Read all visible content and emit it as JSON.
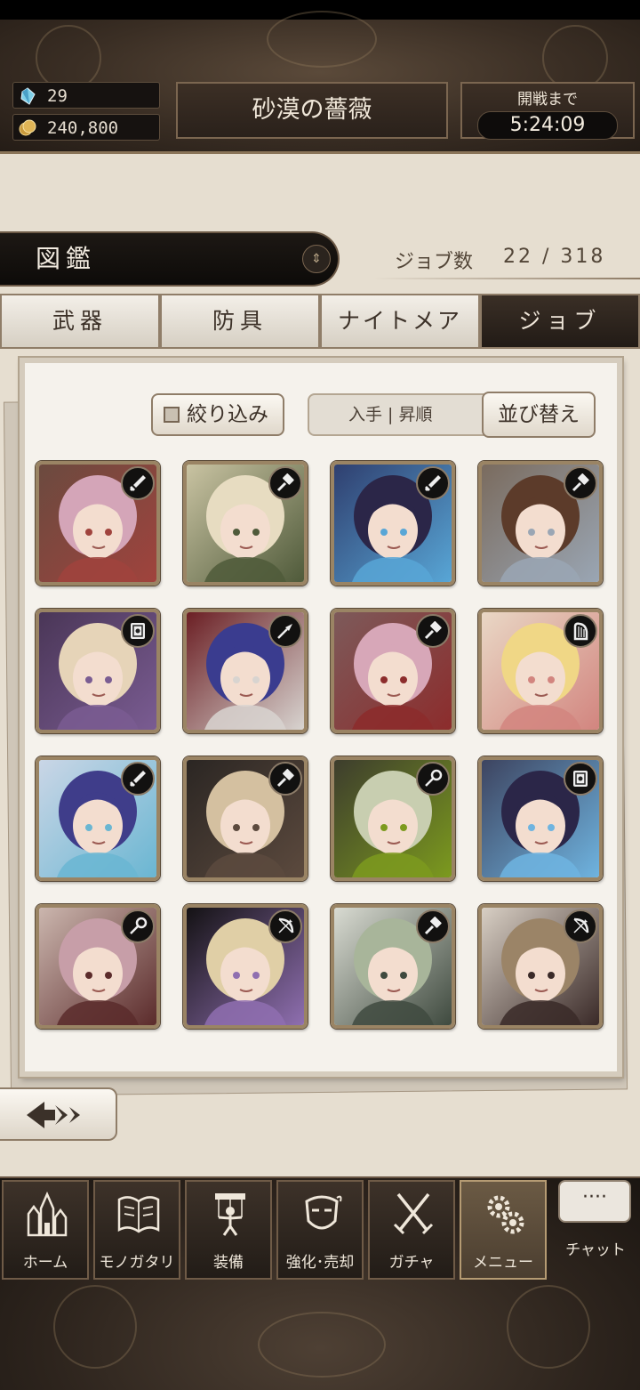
{
  "header": {
    "crystal_count": "29",
    "gold_count": "240,800",
    "stage_name": "砂漠の薔薇",
    "open_label": "開戦まで",
    "open_timer": "5:24:09"
  },
  "title": {
    "text": "図鑑",
    "job_count_label": "ジョブ数",
    "job_count_value": "22 / 318"
  },
  "tabs": [
    {
      "label": "武器",
      "active": false
    },
    {
      "label": "防具",
      "active": false
    },
    {
      "label": "ナイトメア",
      "active": false
    },
    {
      "label": "ジョブ",
      "active": true
    }
  ],
  "controls": {
    "filter_label": "絞り込み",
    "sort_current": "入手 | 昇順",
    "sort_button": "並び替え"
  },
  "jobs": [
    {
      "weapon_icon": "sword-icon",
      "palette": [
        "#6b4a3f",
        "#d4a5b8",
        "#a0433d"
      ]
    },
    {
      "weapon_icon": "hammer-icon",
      "palette": [
        "#c9c3a2",
        "#e7dcc1",
        "#4f5a3a"
      ]
    },
    {
      "weapon_icon": "sword-icon",
      "palette": [
        "#2f3f6f",
        "#2b2648",
        "#58a6d6"
      ]
    },
    {
      "weapon_icon": "hammer-icon",
      "palette": [
        "#7a6b5e",
        "#5c3b2a",
        "#9aa6b4"
      ]
    },
    {
      "weapon_icon": "tome-icon",
      "palette": [
        "#4a3657",
        "#e6d4b8",
        "#7a5c92"
      ]
    },
    {
      "weapon_icon": "spear-icon",
      "palette": [
        "#6b1f24",
        "#3a3c8f",
        "#d8d4d0"
      ]
    },
    {
      "weapon_icon": "hammer-icon",
      "palette": [
        "#7d5a5a",
        "#d7a7b8",
        "#8c2c2c"
      ]
    },
    {
      "weapon_icon": "harp-icon",
      "palette": [
        "#e9d7c5",
        "#f0d786",
        "#d2857f"
      ]
    },
    {
      "weapon_icon": "sword-icon",
      "palette": [
        "#cad6e6",
        "#3f3d8a",
        "#6ab6d2"
      ]
    },
    {
      "weapon_icon": "hammer-icon",
      "palette": [
        "#2b2623",
        "#d4c0a0",
        "#5c4a3e"
      ]
    },
    {
      "weapon_icon": "staff-icon",
      "palette": [
        "#3d3d2d",
        "#c8ceb0",
        "#7c9a1e"
      ]
    },
    {
      "weapon_icon": "tome-icon",
      "palette": [
        "#3d4460",
        "#2b2648",
        "#6fb4e0"
      ]
    },
    {
      "weapon_icon": "staff-icon",
      "palette": [
        "#cbb6ae",
        "#c79ea8",
        "#5b2b2b"
      ]
    },
    {
      "weapon_icon": "bow-icon",
      "palette": [
        "#141214",
        "#e0cfa6",
        "#8f6fb0"
      ]
    },
    {
      "weapon_icon": "hammer-icon",
      "palette": [
        "#d9dbd2",
        "#a8b59a",
        "#3f4a3f"
      ]
    },
    {
      "weapon_icon": "bow-icon",
      "palette": [
        "#d8cfc4",
        "#9b8467",
        "#3a2a28"
      ]
    }
  ],
  "nav": [
    {
      "label": "ホーム",
      "icon": "castle-icon",
      "active": false
    },
    {
      "label": "モノガタリ",
      "icon": "book-icon",
      "active": false
    },
    {
      "label": "装備",
      "icon": "puppet-icon",
      "active": false
    },
    {
      "label": "強化･売却",
      "icon": "mask-icon",
      "active": false
    },
    {
      "label": "ガチャ",
      "icon": "crossed-swords-icon",
      "active": false
    },
    {
      "label": "メニュー",
      "icon": "gears-icon",
      "active": true
    }
  ],
  "chat": {
    "bubble": "····",
    "label": "チャット"
  }
}
